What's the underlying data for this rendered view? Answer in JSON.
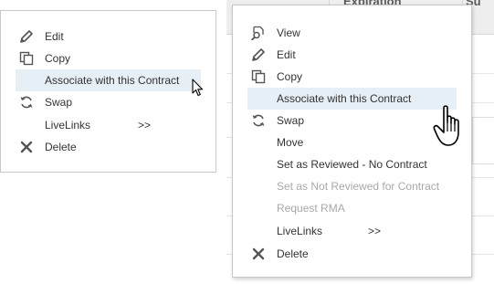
{
  "table": {
    "headers": [
      "Expiration",
      "Su"
    ]
  },
  "menu_left": {
    "items": [
      {
        "label": "Edit",
        "icon": "pencil-icon"
      },
      {
        "label": "Copy",
        "icon": "copy-icon"
      },
      {
        "label": "Associate with this Contract",
        "icon": ""
      },
      {
        "label": "Swap",
        "icon": "swap-icon"
      },
      {
        "label": "LiveLinks",
        "icon": ""
      },
      {
        "label": "Delete",
        "icon": "close-icon"
      }
    ],
    "submenu_arrow": ">>"
  },
  "menu_right": {
    "items": [
      {
        "label": "View",
        "icon": "view-icon"
      },
      {
        "label": "Edit",
        "icon": "pencil-icon"
      },
      {
        "label": "Copy",
        "icon": "copy-icon"
      },
      {
        "label": "Associate with this Contract",
        "icon": ""
      },
      {
        "label": "Swap",
        "icon": "swap-icon"
      },
      {
        "label": "Move",
        "icon": ""
      },
      {
        "label": "Set as Reviewed - No Contract",
        "icon": ""
      },
      {
        "label": "Set as Not Reviewed for Contract",
        "icon": "",
        "disabled": true
      },
      {
        "label": "Request RMA",
        "icon": "",
        "disabled": true
      },
      {
        "label": "LiveLinks",
        "icon": ""
      },
      {
        "label": "Delete",
        "icon": "close-icon"
      }
    ],
    "submenu_arrow": ">>"
  },
  "colors": {
    "highlight": "#e6eef6",
    "text": "#333333",
    "disabled_text": "#a8a8a8",
    "border": "#c8c8c8"
  }
}
